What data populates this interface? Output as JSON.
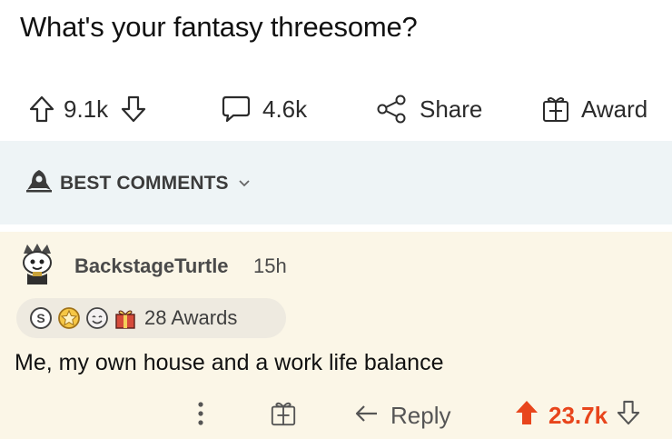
{
  "post": {
    "title": "What's your fantasy threesome?",
    "upvotes": "9.1k",
    "comments": "4.6k",
    "share_label": "Share",
    "award_label": "Award"
  },
  "sort": {
    "label": "BEST COMMENTS"
  },
  "comment": {
    "username": "BackstageTurtle",
    "timestamp": "15h",
    "awards_label": "28 Awards",
    "body": "Me, my own house and a work life balance",
    "reply_label": "Reply",
    "score": "23.7k"
  },
  "colors": {
    "upvote_active": "#e8451c",
    "sort_bar_bg": "#eef4f6",
    "comment_highlight_bg": "#fbf6e7"
  },
  "icons": [
    "upvote-arrow-icon",
    "downvote-arrow-icon",
    "comment-bubble-icon",
    "share-icon",
    "gift-icon",
    "rocket-icon",
    "chevron-down-icon",
    "avatar-icon",
    "silver-award-icon",
    "gold-award-icon",
    "wholesome-award-icon",
    "gift-award-icon",
    "more-dots-icon",
    "reply-icon"
  ]
}
